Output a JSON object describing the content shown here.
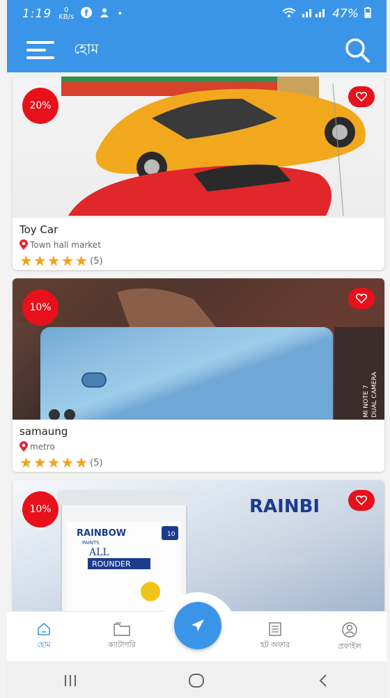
{
  "status_bar": {
    "time": "1:19",
    "data_rate": "0 KB/s",
    "battery": "47%"
  },
  "app_bar": {
    "title": "হোম",
    "menu_icon": "hamburger-menu-icon",
    "search_icon": "search-icon"
  },
  "products": [
    {
      "name": "Toy Car",
      "location": "Town hall market",
      "discount": "20%",
      "rating_count": "(5)",
      "stars": 5
    },
    {
      "name": "samaung",
      "location": "metro",
      "discount": "10%",
      "rating_count": "(5)",
      "stars": 5,
      "image_text": "MI NOTE 7 DUAL CAMERA"
    },
    {
      "name": "",
      "location": "",
      "discount": "10%",
      "image_text": "RAINBOW PAINTS ALL ROUNDER"
    }
  ],
  "bottom_nav": {
    "items": [
      {
        "label": "হোম",
        "icon": "home-icon",
        "active": true
      },
      {
        "label": "ক্যাটাগরি",
        "icon": "folder-icon",
        "active": false
      },
      {
        "label": "হট অফার",
        "icon": "list-icon",
        "active": false
      },
      {
        "label": "প্রফাইল",
        "icon": "profile-icon",
        "active": false
      }
    ],
    "fab_icon": "send-arrow-icon"
  },
  "colors": {
    "primary": "#3a95e8",
    "badge": "#e8101a",
    "star": "#f2a31b"
  }
}
